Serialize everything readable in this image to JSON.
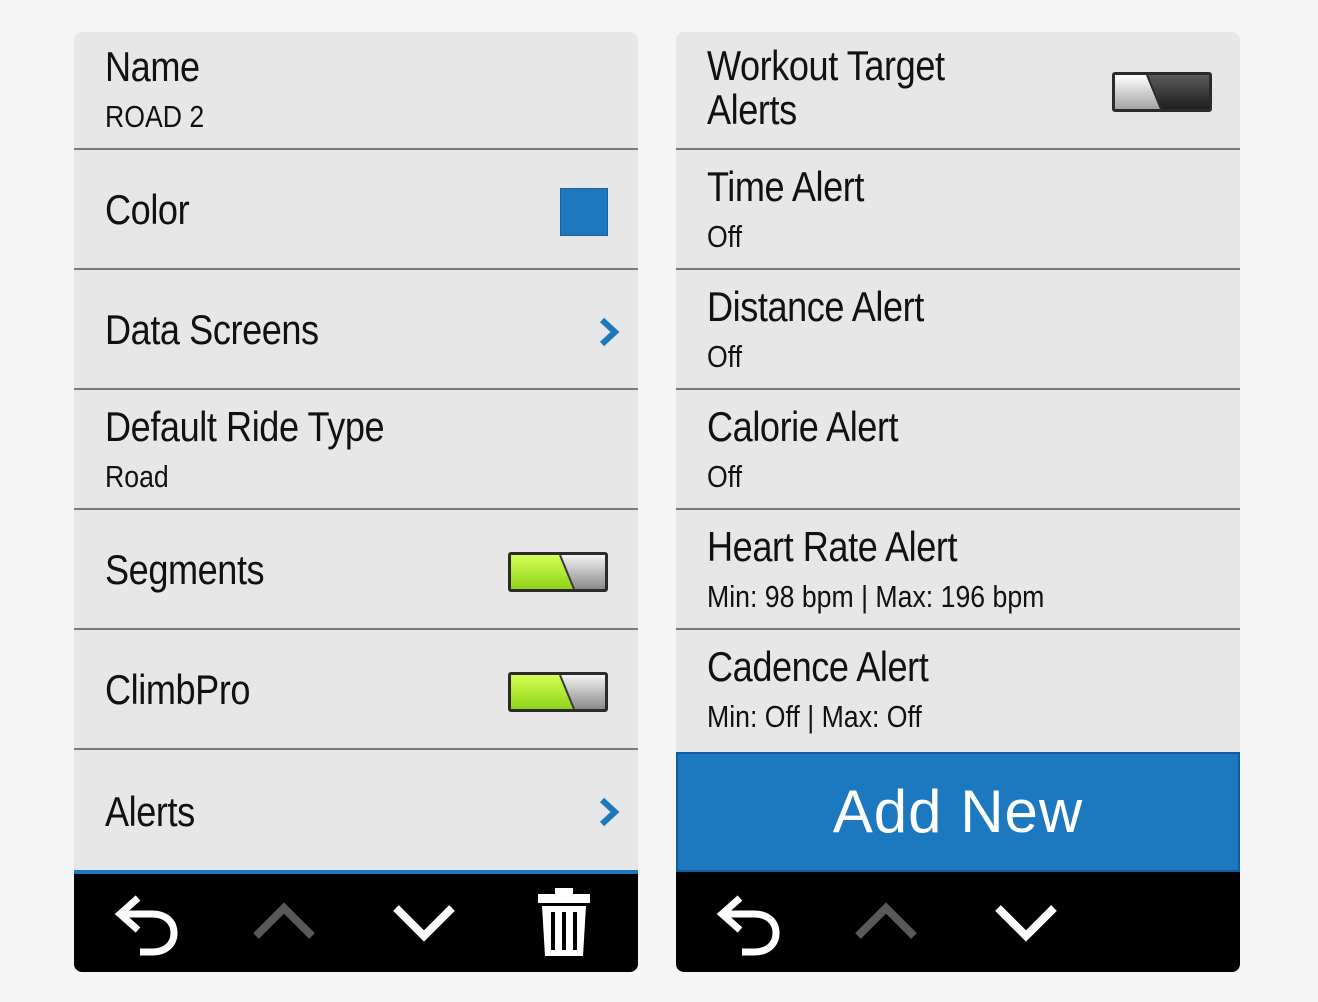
{
  "left_screen": {
    "rows": [
      {
        "title": "Name",
        "value": "ROAD 2"
      },
      {
        "title": "Color",
        "color": "#1d78bf"
      },
      {
        "title": "Data Screens"
      },
      {
        "title": "Default Ride Type",
        "value": "Road"
      },
      {
        "title": "Segments",
        "toggle": "on"
      },
      {
        "title": "ClimbPro",
        "toggle": "on"
      },
      {
        "title": "Alerts"
      }
    ]
  },
  "right_screen": {
    "rows": [
      {
        "title": "Workout Target Alerts",
        "toggle": "off"
      },
      {
        "title": "Time Alert",
        "value": "Off"
      },
      {
        "title": "Distance Alert",
        "value": "Off"
      },
      {
        "title": "Calorie Alert",
        "value": "Off"
      },
      {
        "title": "Heart Rate Alert",
        "value": "Min: 98 bpm | Max: 196 bpm"
      },
      {
        "title": "Cadence Alert",
        "value": "Min: Off | Max: Off"
      }
    ],
    "add_new_label": "Add New"
  },
  "icons": {
    "back": "back-arrow-icon",
    "up": "chevron-up-icon",
    "down": "chevron-down-icon",
    "delete": "trash-icon",
    "next": "chevron-right-icon"
  },
  "colors": {
    "accent_blue": "#1c78bf",
    "toggle_on_green": "#b6f032",
    "background": "#e7e7e7",
    "toolbar": "#000000"
  }
}
